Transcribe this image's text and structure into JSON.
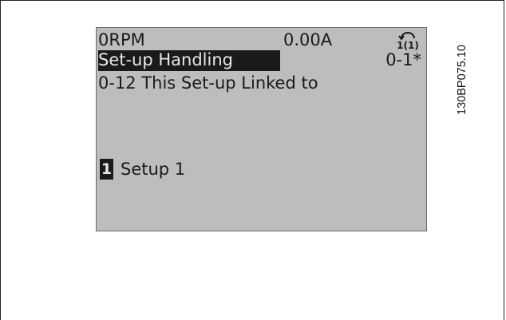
{
  "display": {
    "speed": "0RPM",
    "current": "0.00A",
    "setup_indicator": "1(1)",
    "menu_title": "Set-up Handling",
    "menu_code": "0-1*",
    "parameter": "0-12 This Set-up Linked to",
    "selected_index": "1",
    "selected_value": "Setup 1"
  },
  "figure_code": "130BP075.10",
  "colors": {
    "lcd_background": "#bdbdbd",
    "lcd_text": "#1a1a1a"
  }
}
